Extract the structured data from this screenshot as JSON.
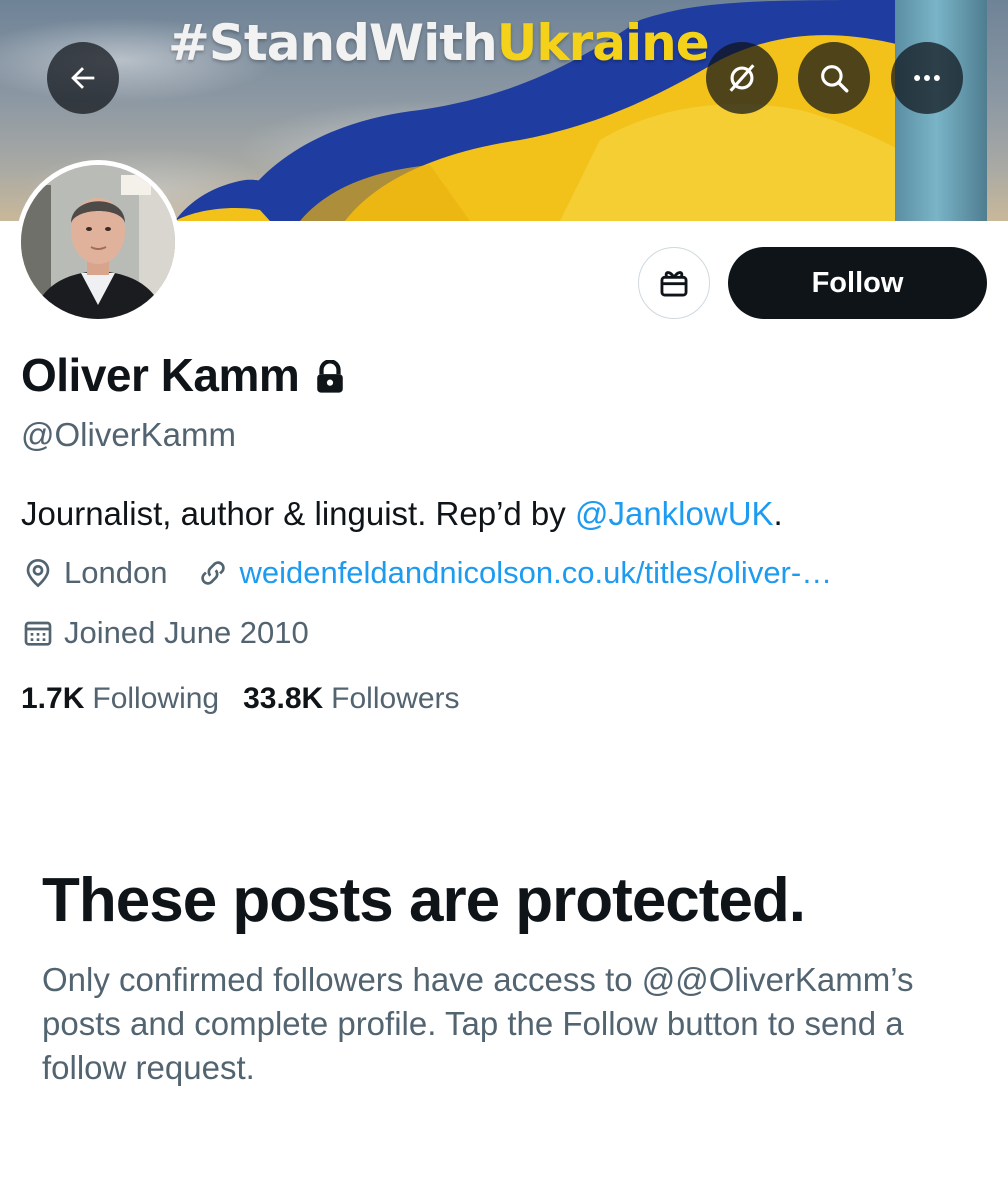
{
  "banner": {
    "hashtag_white": "#StandWith",
    "hashtag_yellow": "Ukraine",
    "flag_colors": {
      "blue": "#1f3ca0",
      "yellow": "#f2c21a"
    }
  },
  "header_icons": {
    "back": "back-arrow-icon",
    "grok": "grok-icon",
    "search": "search-icon",
    "more": "more-icon"
  },
  "profile": {
    "name": "Oliver Kamm",
    "protected_icon": "lock-icon",
    "handle": "@OliverKamm",
    "bio_text": "Journalist, author & linguist. Rep’d by ",
    "bio_mention": "@JanklowUK",
    "bio_end": ".",
    "location": "London",
    "website": "weidenfeldandnicolson.co.uk/titles/oliver-…",
    "joined": "Joined June 2010",
    "following_count": "1.7K",
    "following_label": "Following",
    "followers_count": "33.8K",
    "followers_label": "Followers"
  },
  "actions": {
    "gift_icon": "gift-icon",
    "follow_label": "Follow"
  },
  "protected_notice": {
    "title": "These posts are protected.",
    "body": "Only confirmed followers have access to @@OliverKamm’s posts and complete profile. Tap the Follow button to send a follow request."
  },
  "colors": {
    "accent_link": "#1d9bf0",
    "text_primary": "#0f1419",
    "text_secondary": "#536471"
  }
}
